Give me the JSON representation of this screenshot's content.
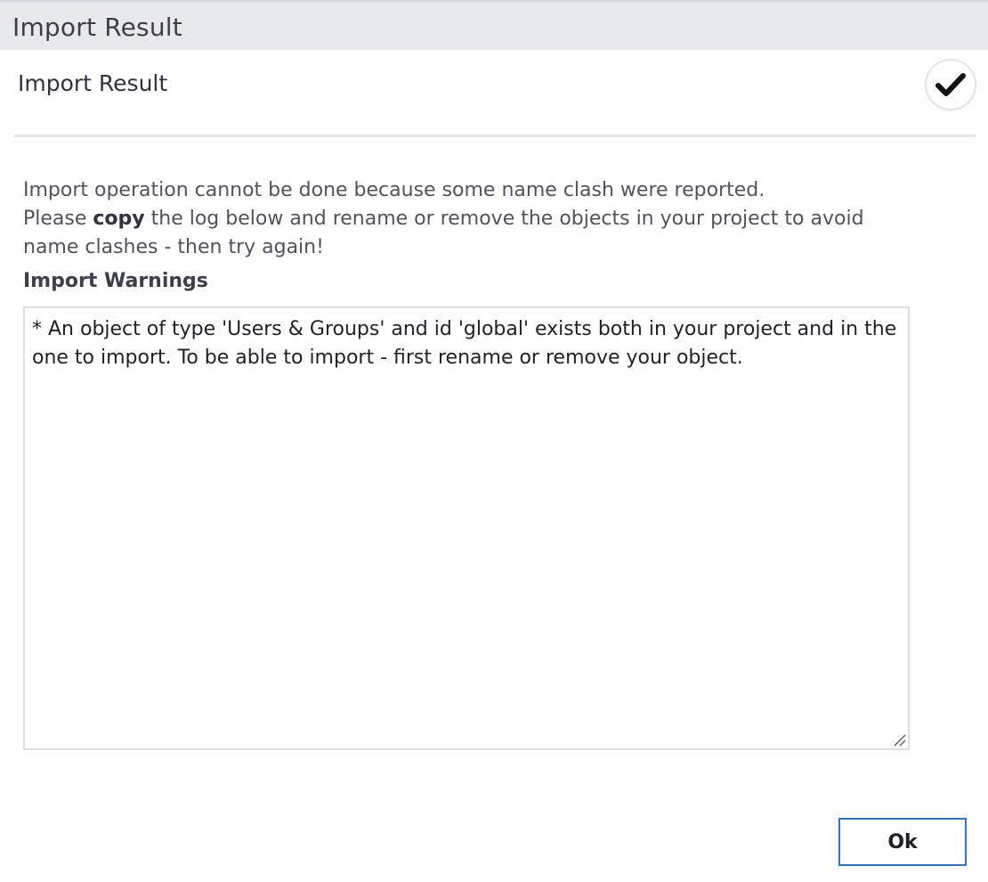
{
  "window": {
    "title": "Import Result"
  },
  "header": {
    "title": "Import Result",
    "status_icon": "checkmark-icon"
  },
  "message": {
    "line1": "Import operation cannot be done because some name clash were reported.",
    "line2_prefix": "Please ",
    "line2_bold": "copy",
    "line2_suffix": " the log below and rename or remove the objects in your project to avoid name clashes - then try again!"
  },
  "warnings": {
    "label": "Import Warnings",
    "log": "* An object of type 'Users & Groups' and id 'global' exists both in your project and in the one to import. To be able to import - first rename or remove your object."
  },
  "actions": {
    "ok_label": "Ok"
  },
  "colors": {
    "titlebar_bg": "#e8e9ed",
    "button_border": "#2f6fdf",
    "text_primary": "#2f3240"
  }
}
